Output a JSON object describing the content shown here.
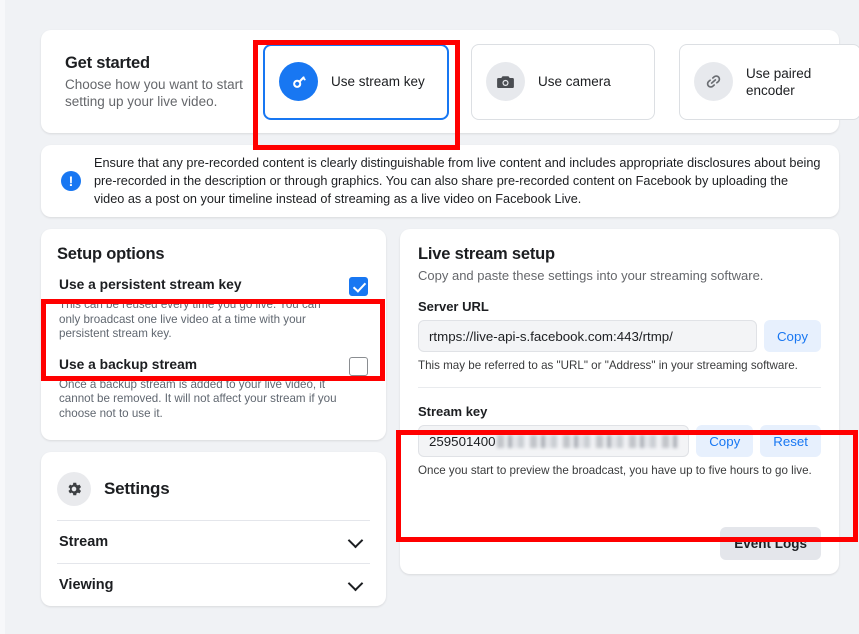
{
  "get_started": {
    "title": "Get started",
    "subtitle": "Choose how you want to start setting up your live video.",
    "options": [
      {
        "label": "Use stream key",
        "icon": "key-icon",
        "selected": true
      },
      {
        "label": "Use camera",
        "icon": "camera-icon",
        "selected": false
      },
      {
        "label": "Use paired encoder",
        "icon": "link-icon",
        "selected": false
      }
    ]
  },
  "notice": {
    "icon": "exclamation-icon",
    "text": "Ensure that any pre-recorded content is clearly distinguishable from live content and includes appropriate disclosures about being pre-recorded in the description or through graphics. You can also share pre-recorded content on Facebook by uploading the video as a post on your timeline instead of streaming as a live video on Facebook Live."
  },
  "setup_options": {
    "title": "Setup options",
    "rows": [
      {
        "title": "Use a persistent stream key",
        "desc": "This can be reused every time you go live. You can only broadcast one live video at a time with your persistent stream key.",
        "checked": true
      },
      {
        "title": "Use a backup stream",
        "desc": "Once a backup stream is added to your live video, it cannot be removed. It will not affect your stream if you choose not to use it.",
        "checked": false
      }
    ]
  },
  "settings": {
    "title": "Settings",
    "icon": "gear-icon",
    "rows": [
      {
        "label": "Stream",
        "chevron": "chevron-down-icon"
      },
      {
        "label": "Viewing",
        "chevron": "chevron-down-icon"
      }
    ]
  },
  "live_stream_setup": {
    "title": "Live stream setup",
    "subtitle": "Copy and paste these settings into your streaming software.",
    "server_url": {
      "label": "Server URL",
      "value": "rtmps://live-api-s.facebook.com:443/rtmp/",
      "copy_label": "Copy",
      "hint": "This may be referred to as \"URL\" or \"Address\" in your streaming software."
    },
    "stream_key": {
      "label": "Stream key",
      "value_visible": "259501400",
      "copy_label": "Copy",
      "reset_label": "Reset",
      "hint": "Once you start to preview the broadcast, you have up to five hours to go live."
    },
    "event_logs_label": "Event Logs"
  },
  "colors": {
    "accent": "#1877f2",
    "highlight": "#ff0000",
    "page_bg": "#f0f2f5",
    "card_bg": "#ffffff",
    "muted_text": "#65676b"
  }
}
